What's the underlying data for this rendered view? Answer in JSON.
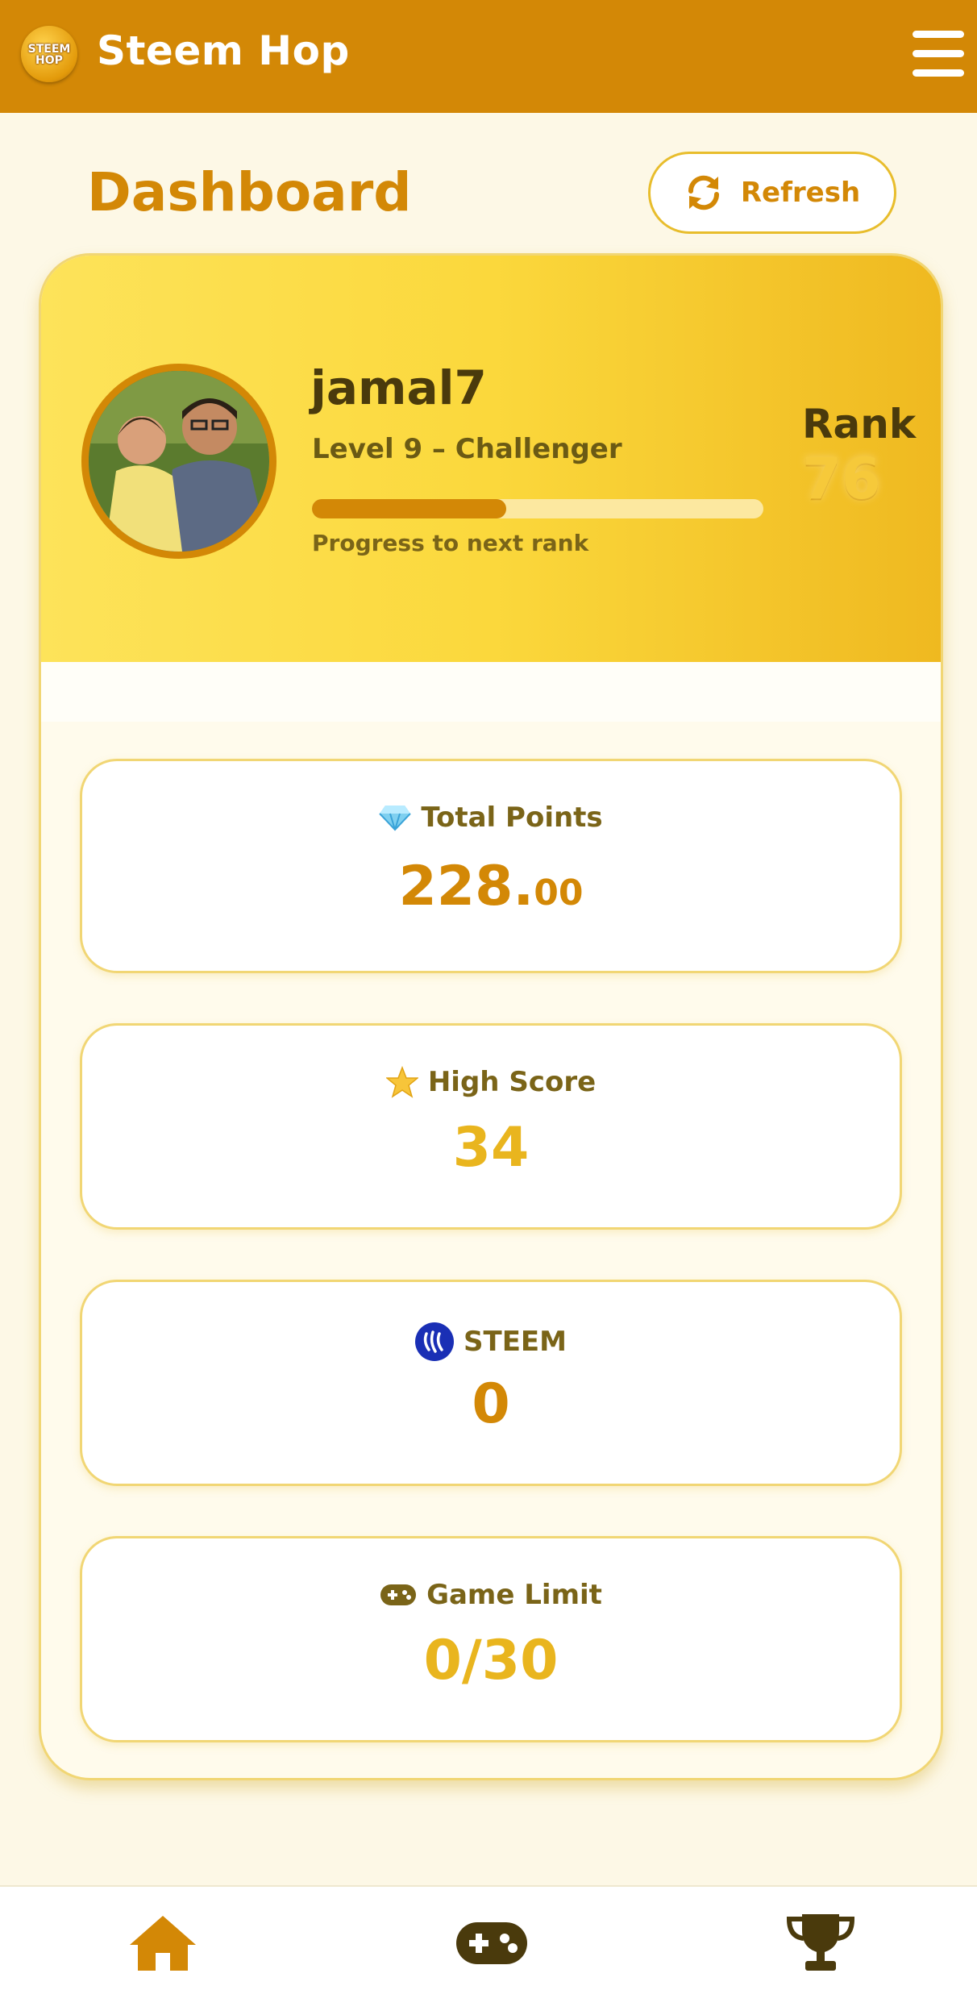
{
  "app": {
    "logo_text": "STEEM HOP",
    "title": "Steem Hop"
  },
  "page": {
    "title": "Dashboard",
    "refresh_label": "Refresh"
  },
  "profile": {
    "username": "jamal7",
    "level_text": "Level 9 – Challenger",
    "progress_label": "Progress to next rank",
    "progress_fraction": 0.43,
    "rank_label": "Rank",
    "rank_value": "76"
  },
  "stats": [
    {
      "icon": "diamond-icon",
      "label": "Total Points",
      "value_main": "228.",
      "value_small": "00",
      "color": "#d38806"
    },
    {
      "icon": "star-icon",
      "label": "High Score",
      "value_main": "34",
      "value_small": "",
      "color": "#e9b51e"
    },
    {
      "icon": "steem-icon",
      "label": "STEEM",
      "value_main": "0",
      "value_small": "",
      "color": "#d38806"
    },
    {
      "icon": "gamepad-icon",
      "label": "Game Limit",
      "value_main": "0/30",
      "value_small": "",
      "color": "#e9b51e"
    }
  ],
  "nav": [
    {
      "icon": "home-icon"
    },
    {
      "icon": "gamepad-icon"
    },
    {
      "icon": "trophy-icon"
    }
  ],
  "colors": {
    "brand": "#d38806",
    "accent": "#f6c93a",
    "steem": "#1a2fb5"
  }
}
